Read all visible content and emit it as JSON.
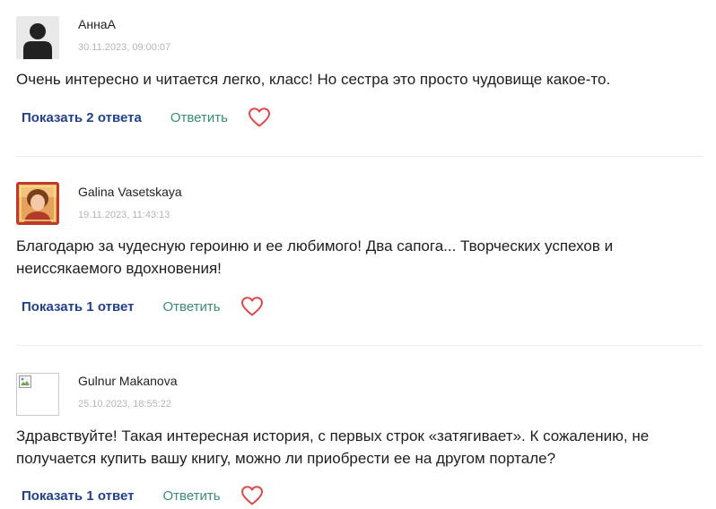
{
  "comments": [
    {
      "author": "АннаА",
      "date": "30.11.2023, 09:00:07",
      "text": "Очень интересно и читается легко, класс! Но сестра это просто чудовище какое-то.",
      "show_replies_label": "Показать 2 ответа",
      "reply_label": "Ответить",
      "avatar": "user-placeholder-icon"
    },
    {
      "author": "Galina Vasetskaya",
      "date": "19.11.2023, 11:43:13",
      "text": "Благодарю за чудесную героиню и ее любимого! Два сапога... Творческих успехов и неиссякаемого вдохновения!",
      "show_replies_label": "Показать 1 ответ",
      "reply_label": "Ответить",
      "avatar": "user-photo"
    },
    {
      "author": "Gulnur Makanova",
      "date": "25.10.2023, 18:55:22",
      "text": "Здравствуйте! Такая интересная история, с первых строк «затягивает». К сожалению, не получается купить вашу книгу, можно ли приобрести ее на другом портале?",
      "show_replies_label": "Показать 1 ответ",
      "reply_label": "Ответить",
      "avatar": "broken-image-icon"
    }
  ],
  "colors": {
    "show_replies": "#22408a",
    "reply": "#3a8d74",
    "like_heart": "#e0474c",
    "date": "#b5b5b5",
    "divider": "#ececec"
  },
  "icons": {
    "like": "heart-icon"
  }
}
